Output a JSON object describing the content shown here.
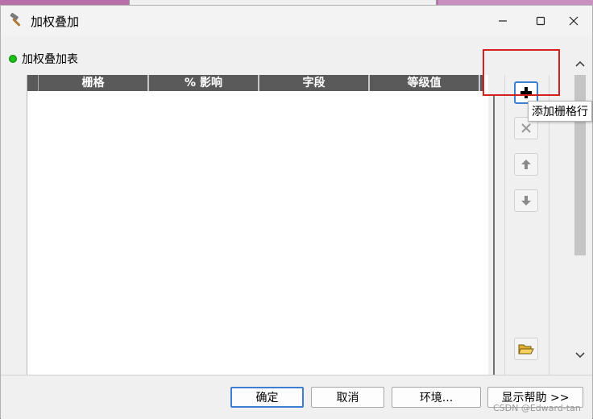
{
  "window": {
    "title": "加权叠加"
  },
  "section": {
    "label": "加权叠加表"
  },
  "table": {
    "headers": [
      "栅格",
      "% 影响",
      "字段",
      "等级值"
    ]
  },
  "tools": {
    "add_tooltip": "添加栅格行"
  },
  "footer": {
    "ok_label": "确定",
    "cancel_label": "取消",
    "env_label": "环境...",
    "help_label": "显示帮助 >>"
  },
  "watermark": "CSDN @Edward-tan",
  "colors": {
    "header_bg": "#5a5a5a",
    "focus_border": "#3c7fd0",
    "highlight": "#d42020",
    "status_dot": "#18c018"
  }
}
